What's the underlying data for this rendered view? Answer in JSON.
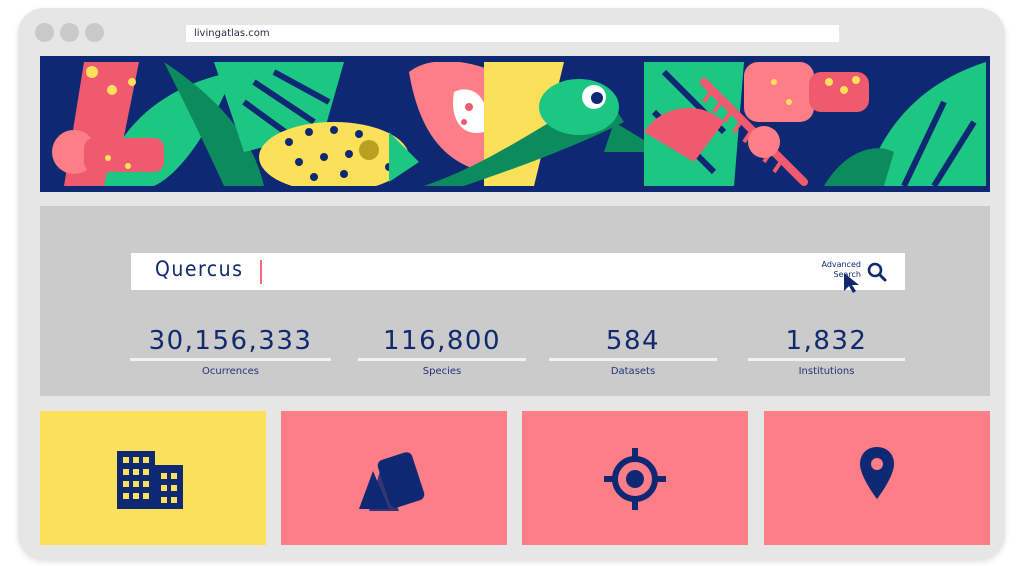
{
  "browser": {
    "url": "livingatlas.com"
  },
  "search": {
    "value": "Quercus",
    "advanced_label_line1": "Advanced",
    "advanced_label_line2": "Search"
  },
  "stats": [
    {
      "value": "30,156,333",
      "label": "Ocurrences"
    },
    {
      "value": "116,800",
      "label": "Species"
    },
    {
      "value": "584",
      "label": "Datasets"
    },
    {
      "value": "1,832",
      "label": "Institutions"
    }
  ],
  "tiles": [
    {
      "icon": "building-icon",
      "color": "#fde05a"
    },
    {
      "icon": "cards-icon",
      "color": "#fd7e87"
    },
    {
      "icon": "target-icon",
      "color": "#fd7e87"
    },
    {
      "icon": "location-pin-icon",
      "color": "#fd7e87"
    }
  ],
  "colors": {
    "navy": "#0e2873",
    "yellow": "#fde05a",
    "pink": "#fd7e87",
    "green": "#1ec684"
  }
}
